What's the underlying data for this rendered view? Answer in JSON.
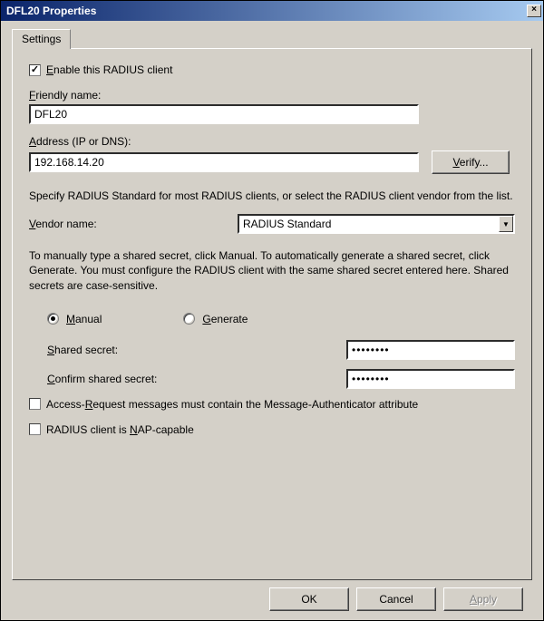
{
  "window": {
    "title": "DFL20 Properties"
  },
  "tabs": {
    "settings": "Settings"
  },
  "enable": {
    "label_pre": "E",
    "label_rest": "nable this RADIUS client",
    "checked": true
  },
  "friendly": {
    "label_pre": "F",
    "label_rest": "riendly name:",
    "value": "DFL20"
  },
  "address": {
    "label_pre": "A",
    "label_rest": "ddress (IP or DNS):",
    "value": "192.168.14.20",
    "verify_pre": "V",
    "verify_rest": "erify..."
  },
  "desc1": "Specify RADIUS Standard for most RADIUS clients, or select the RADIUS client vendor from the list.",
  "vendor": {
    "label_pre": "V",
    "label_rest": "endor name:",
    "value": "RADIUS Standard"
  },
  "desc2": "To manually type a shared secret, click Manual. To automatically generate a shared secret, click Generate. You must configure the RADIUS client with the same shared secret entered here. Shared secrets are case-sensitive.",
  "radio": {
    "manual_pre": "M",
    "manual_rest": "anual",
    "generate_pre": "G",
    "generate_rest": "enerate",
    "selected": "manual"
  },
  "secret": {
    "label_pre": "S",
    "label_rest": "hared secret:",
    "value": "••••••••"
  },
  "confirm": {
    "label_pre": "C",
    "label_rest": "onfirm shared secret:",
    "value": "••••••••"
  },
  "msgauth": {
    "label_pre_a": "Access-",
    "accel": "R",
    "label_rest": "equest messages must contain the Message-Authenticator attribute",
    "checked": false
  },
  "nap": {
    "label_pre": "RADIUS client is ",
    "accel": "N",
    "label_rest": "AP-capable",
    "checked": false
  },
  "buttons": {
    "ok": "OK",
    "cancel": "Cancel",
    "apply_pre": "A",
    "apply_rest": "pply"
  }
}
